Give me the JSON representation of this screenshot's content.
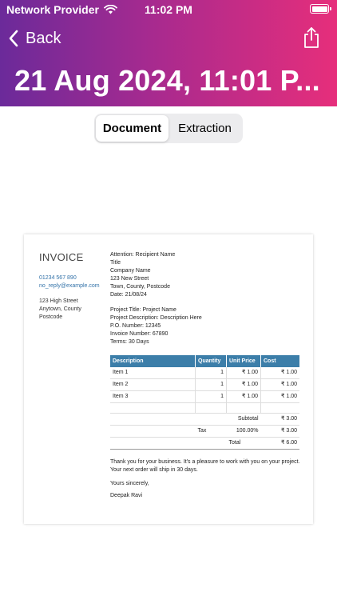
{
  "status_bar": {
    "carrier": "Network Provider",
    "time": "11:02 PM"
  },
  "nav": {
    "back_label": "Back",
    "title": "21 Aug 2024, 11:01 P..."
  },
  "segments": {
    "document": "Document",
    "extraction": "Extraction",
    "selected": "Document"
  },
  "invoice": {
    "title": "INVOICE",
    "from": {
      "phone": "01234 567 890",
      "email": "no_reply@example.com",
      "address": [
        "123 High Street",
        "Anytown, County",
        "Postcode"
      ]
    },
    "recipient": [
      "Attention: Recipient Name",
      "Title",
      "Company Name",
      "123 New Street",
      "Town, County, Postcode",
      "Date: 21/08/24"
    ],
    "project": [
      "Project Title: Project Name",
      "Project Description: Description Here",
      "P.O. Number: 12345",
      "Invoice Number: 67890",
      "Terms: 30 Days"
    ],
    "table": {
      "headers": [
        "Description",
        "Quantity",
        "Unit Price",
        "Cost"
      ],
      "rows": [
        [
          "Item 1",
          "1",
          "₹ 1.00",
          "₹ 1.00"
        ],
        [
          "Item 2",
          "1",
          "₹ 1.00",
          "₹ 1.00"
        ],
        [
          "Item 3",
          "1",
          "₹ 1.00",
          "₹ 1.00"
        ]
      ],
      "subtotal_label": "Subtotal",
      "subtotal_value": "₹ 3.00",
      "tax_label": "Tax",
      "tax_rate": "100.00%",
      "tax_value": "₹ 3.00",
      "total_label": "Total",
      "total_value": "₹ 6.00"
    },
    "thanks": "Thank you for your business. It's a pleasure to work with you on your project. Your next order will ship in 30 days.",
    "closing": "Yours sincerely,",
    "signer": "Deepak Ravi"
  },
  "colors": {
    "header_gradient_start": "#6b2a9a",
    "header_gradient_end": "#e62e7b",
    "table_header": "#3c7ea9",
    "contact_link": "#3473a9"
  },
  "icons": {
    "back": "chevron-left-icon",
    "share": "share-icon",
    "wifi": "wifi-icon",
    "battery": "battery-icon"
  }
}
